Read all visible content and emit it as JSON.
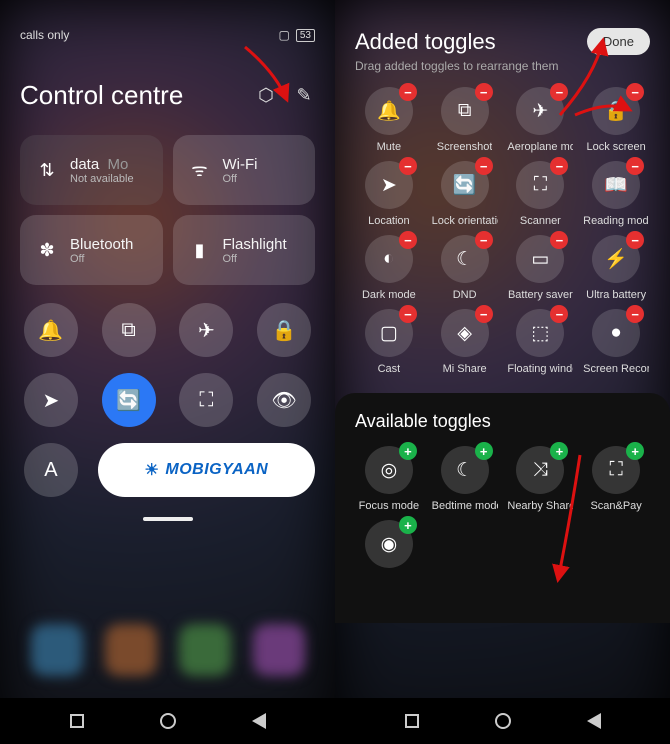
{
  "left": {
    "status": {
      "calls": "calls only",
      "battery": "53"
    },
    "title": "Control centre",
    "big_tiles": [
      {
        "icon": "data-icon",
        "label": "data",
        "sub": "Not available"
      },
      {
        "icon": "wifi-icon",
        "label": "Wi-Fi",
        "sub": "Off"
      },
      {
        "icon": "bluetooth-icon",
        "label": "Bluetooth",
        "sub": "Off"
      },
      {
        "icon": "flashlight-icon",
        "label": "Flashlight",
        "sub": "Off"
      }
    ],
    "small_tiles_row1": [
      "bell-icon",
      "screenshot-icon",
      "airplane-icon",
      "lock-icon"
    ],
    "small_tiles_row2": [
      "location-icon",
      "orientation-icon",
      "scan-icon",
      "eye-icon"
    ],
    "small_tiles_row3_first": "a-letter",
    "logo_text": "MOBIGYAAN",
    "mo_part": "MO"
  },
  "right": {
    "added_title": "Added toggles",
    "subtitle": "Drag added toggles to rearrange them",
    "done": "Done",
    "added": [
      {
        "icon": "bell-icon",
        "label": "Mute"
      },
      {
        "icon": "screenshot-icon",
        "label": "Screenshot"
      },
      {
        "icon": "airplane-icon",
        "label": "Aeroplane mode"
      },
      {
        "icon": "lock-icon",
        "label": "Lock screen"
      },
      {
        "icon": "location-icon",
        "label": "Location"
      },
      {
        "icon": "orientation-icon",
        "label": "Lock orientation"
      },
      {
        "icon": "scan-icon",
        "label": "Scanner"
      },
      {
        "icon": "reading-icon",
        "label": "Reading mode"
      },
      {
        "icon": "darkmode-icon",
        "label": "Dark mode"
      },
      {
        "icon": "dnd-icon",
        "label": "DND"
      },
      {
        "icon": "battery-icon",
        "label": "Battery saver"
      },
      {
        "icon": "bolt-icon",
        "label": "Ultra battery"
      },
      {
        "icon": "cast-icon",
        "label": "Cast"
      },
      {
        "icon": "mishare-icon",
        "label": "Mi Share"
      },
      {
        "icon": "floating-icon",
        "label": "Floating windows"
      },
      {
        "icon": "record-icon",
        "label": "Screen Recorder"
      }
    ],
    "avail_title": "Available toggles",
    "available": [
      {
        "icon": "focus-icon",
        "label": "Focus mode"
      },
      {
        "icon": "bedtime-icon",
        "label": "Bedtime mode"
      },
      {
        "icon": "nearby-icon",
        "label": "Nearby Share"
      },
      {
        "icon": "scanpay-icon",
        "label": "Scan&Pay"
      },
      {
        "icon": "target-icon",
        "label": ""
      }
    ]
  },
  "icons": {
    "data-icon": "⇅",
    "wifi-icon": "ᯤ",
    "bluetooth-icon": "✽",
    "flashlight-icon": "▮",
    "bell-icon": "🔔",
    "screenshot-icon": "⧉",
    "airplane-icon": "✈",
    "lock-icon": "🔒",
    "location-icon": "➤",
    "orientation-icon": "🔄",
    "scan-icon": "⛶",
    "eye-icon": "👁",
    "reading-icon": "📖",
    "darkmode-icon": "◐",
    "dnd-icon": "☾",
    "battery-icon": "▭",
    "bolt-icon": "⚡",
    "cast-icon": "▢",
    "mishare-icon": "◈",
    "floating-icon": "⬚",
    "record-icon": "●",
    "focus-icon": "◎",
    "bedtime-icon": "☾",
    "nearby-icon": "⤨",
    "scanpay-icon": "⛶",
    "target-icon": "◉",
    "a-letter": "A",
    "brightness-icon": "☀",
    "gear-icon": "⬡",
    "edit-icon": "✎",
    "mo-sub": "Mo"
  }
}
